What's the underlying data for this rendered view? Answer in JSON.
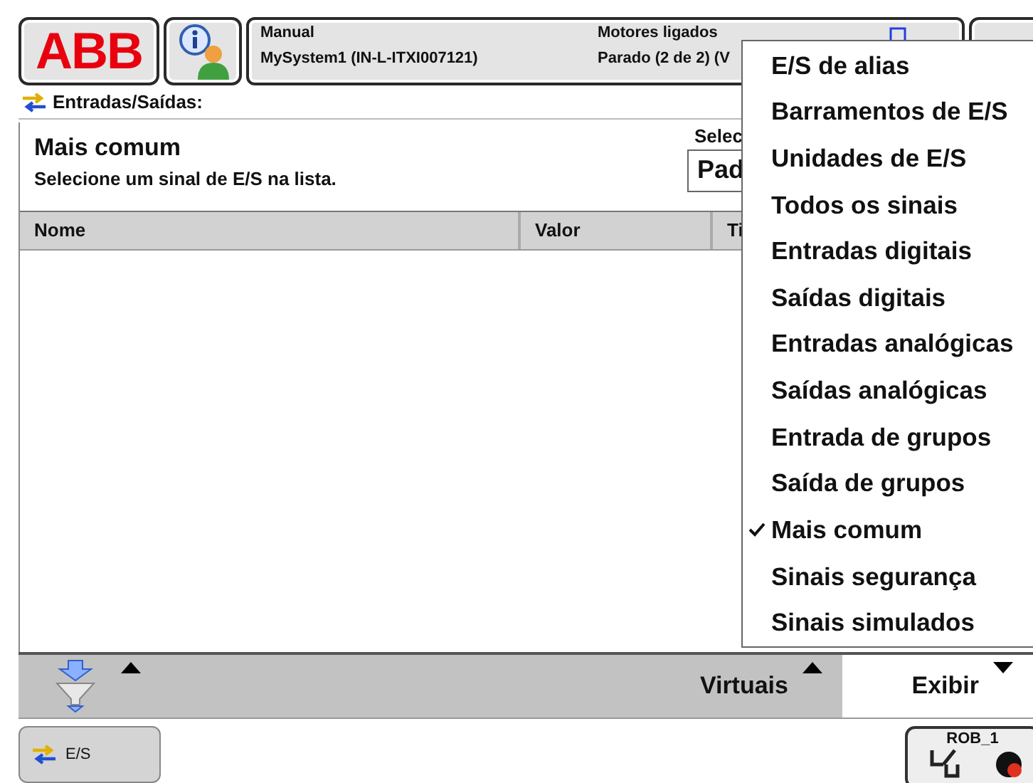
{
  "top_bar": {
    "logo": "ABB",
    "status": {
      "mode": "Manual",
      "system": "MySystem1 (IN-L-ITXI007121)",
      "motors": "Motores ligados",
      "state": "Parado (2 de 2) (V"
    }
  },
  "breadcrumb": "Entradas/Saídas:",
  "view": {
    "title": "Mais comum",
    "subtitle": "Selecione um sinal de E/S na lista.",
    "select_label": "Selec",
    "select_value": "Pad"
  },
  "table": {
    "columns": [
      "Nome",
      "Valor",
      "Ti"
    ]
  },
  "command_bar": [
    {
      "kind": "filter",
      "selected": false
    },
    {
      "kind": "text",
      "label": "Virtuais",
      "selected": false
    },
    {
      "kind": "text",
      "label": "Exibir",
      "selected": true
    }
  ],
  "menu": [
    {
      "label": "E/S de alias",
      "checked": false
    },
    {
      "label": "Barramentos de E/S",
      "checked": false
    },
    {
      "label": "Unidades de E/S",
      "checked": false
    },
    {
      "label": "Todos os sinais",
      "checked": false
    },
    {
      "label": "Entradas digitais",
      "checked": false
    },
    {
      "label": "Saídas digitais",
      "checked": false
    },
    {
      "label": "Entradas analógicas",
      "checked": false
    },
    {
      "label": "Saídas analógicas",
      "checked": false
    },
    {
      "label": "Entrada de grupos",
      "checked": false
    },
    {
      "label": "Saída de grupos",
      "checked": false
    },
    {
      "label": "Mais comum",
      "checked": true
    },
    {
      "label": "Sinais segurança",
      "checked": false
    },
    {
      "label": "Sinais simulados",
      "checked": false
    }
  ],
  "taskbar": {
    "app": "E/S",
    "task": "ROB_1"
  }
}
